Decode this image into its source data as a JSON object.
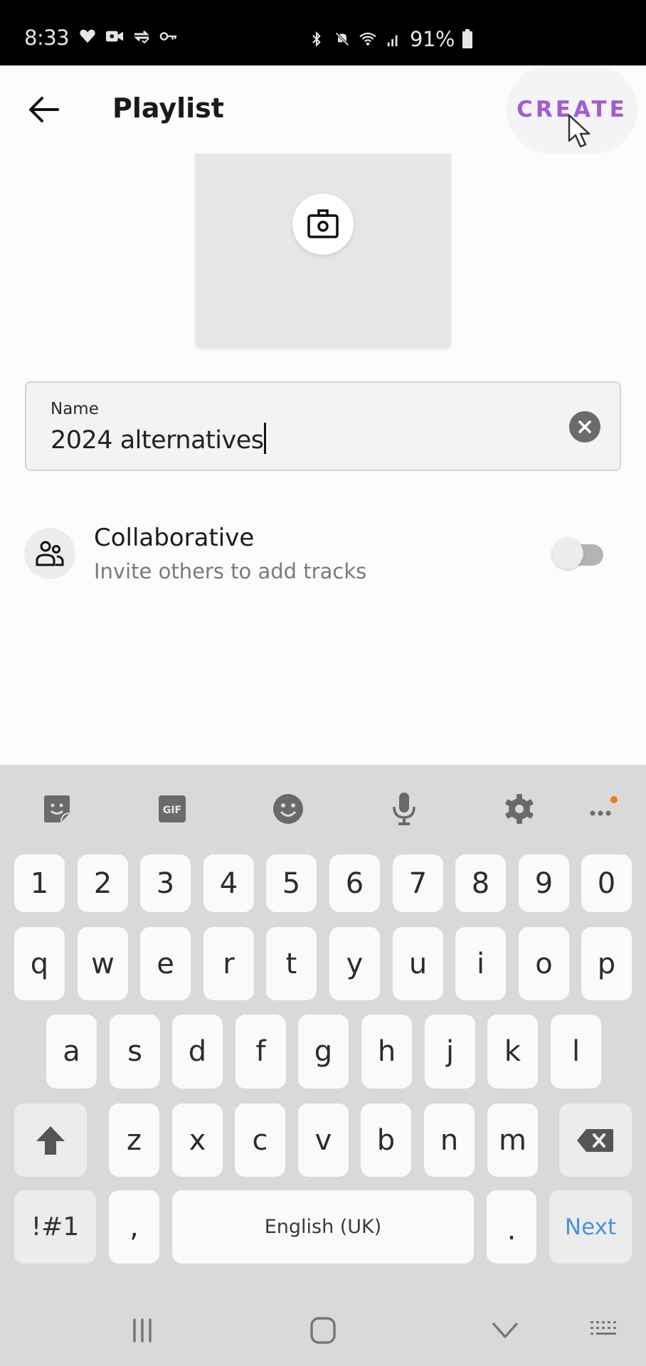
{
  "status_bar": {
    "time": "8:33",
    "left_icons": [
      "heart-icon",
      "video-camera-icon",
      "sync-check-icon",
      "key-icon"
    ],
    "right_icons": [
      "bluetooth-icon",
      "mute-icon",
      "wifi-icon",
      "signal-icon"
    ],
    "battery_percent": "91%"
  },
  "app_bar": {
    "title": "Playlist",
    "back_icon": "arrow-left-icon",
    "create_label": "CREATE",
    "accent_color": "#a15ad8"
  },
  "cover": {
    "camera_icon": "camera-icon"
  },
  "name_field": {
    "label": "Name",
    "value": "2024 alternatives",
    "clear_icon": "clear-icon"
  },
  "collaborative": {
    "title": "Collaborative",
    "subtitle": "Invite others to add tracks",
    "enabled": false
  },
  "keyboard": {
    "toolbar": [
      "sticker-icon",
      "gif-icon",
      "emoji-icon",
      "microphone-icon",
      "settings-icon",
      "more-icon"
    ],
    "gif_label": "GIF",
    "rows": [
      [
        "1",
        "2",
        "3",
        "4",
        "5",
        "6",
        "7",
        "8",
        "9",
        "0"
      ],
      [
        "q",
        "w",
        "e",
        "r",
        "t",
        "y",
        "u",
        "i",
        "o",
        "p"
      ],
      [
        "a",
        "s",
        "d",
        "f",
        "g",
        "h",
        "j",
        "k",
        "l"
      ],
      [
        "z",
        "x",
        "c",
        "v",
        "b",
        "n",
        "m"
      ]
    ],
    "symbols_label": "!#1",
    "comma_label": ",",
    "space_label": "English (UK)",
    "period_label": ".",
    "action_label": "Next",
    "action_color": "#4a90e2"
  },
  "nav_bar": {
    "buttons": [
      "recent-apps-icon",
      "home-icon",
      "hide-keyboard-icon",
      "keyboard-switch-icon"
    ]
  }
}
